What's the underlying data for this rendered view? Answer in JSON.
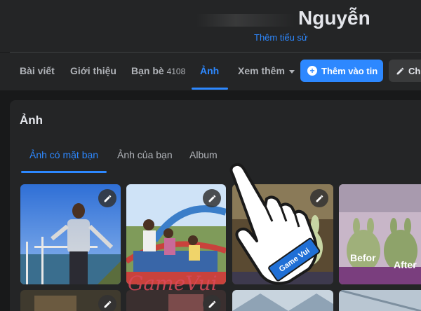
{
  "profile": {
    "name": "Nguyễn",
    "add_bio": "Thêm tiểu sử"
  },
  "nav": {
    "items": [
      {
        "label": "Bài viết"
      },
      {
        "label": "Giới thiệu"
      },
      {
        "label": "Bạn bè",
        "count": "4108"
      },
      {
        "label": "Ảnh",
        "active": true
      },
      {
        "label": "Xem thêm"
      }
    ],
    "add_story_label": "Thêm vào tin",
    "edit_label": "Ch"
  },
  "photos": {
    "title": "Ảnh",
    "tabs": [
      {
        "label": "Ảnh có mặt bạn",
        "active": true
      },
      {
        "label": "Ảnh của bạn"
      },
      {
        "label": "Album"
      }
    ],
    "overlay_texts": [
      "Befor",
      "After"
    ]
  },
  "watermark": {
    "logo_text": "GameVui",
    "badge_text": "Game Vui"
  },
  "colors": {
    "accent": "#2d88ff",
    "background": "#18191a",
    "surface": "#242526"
  }
}
